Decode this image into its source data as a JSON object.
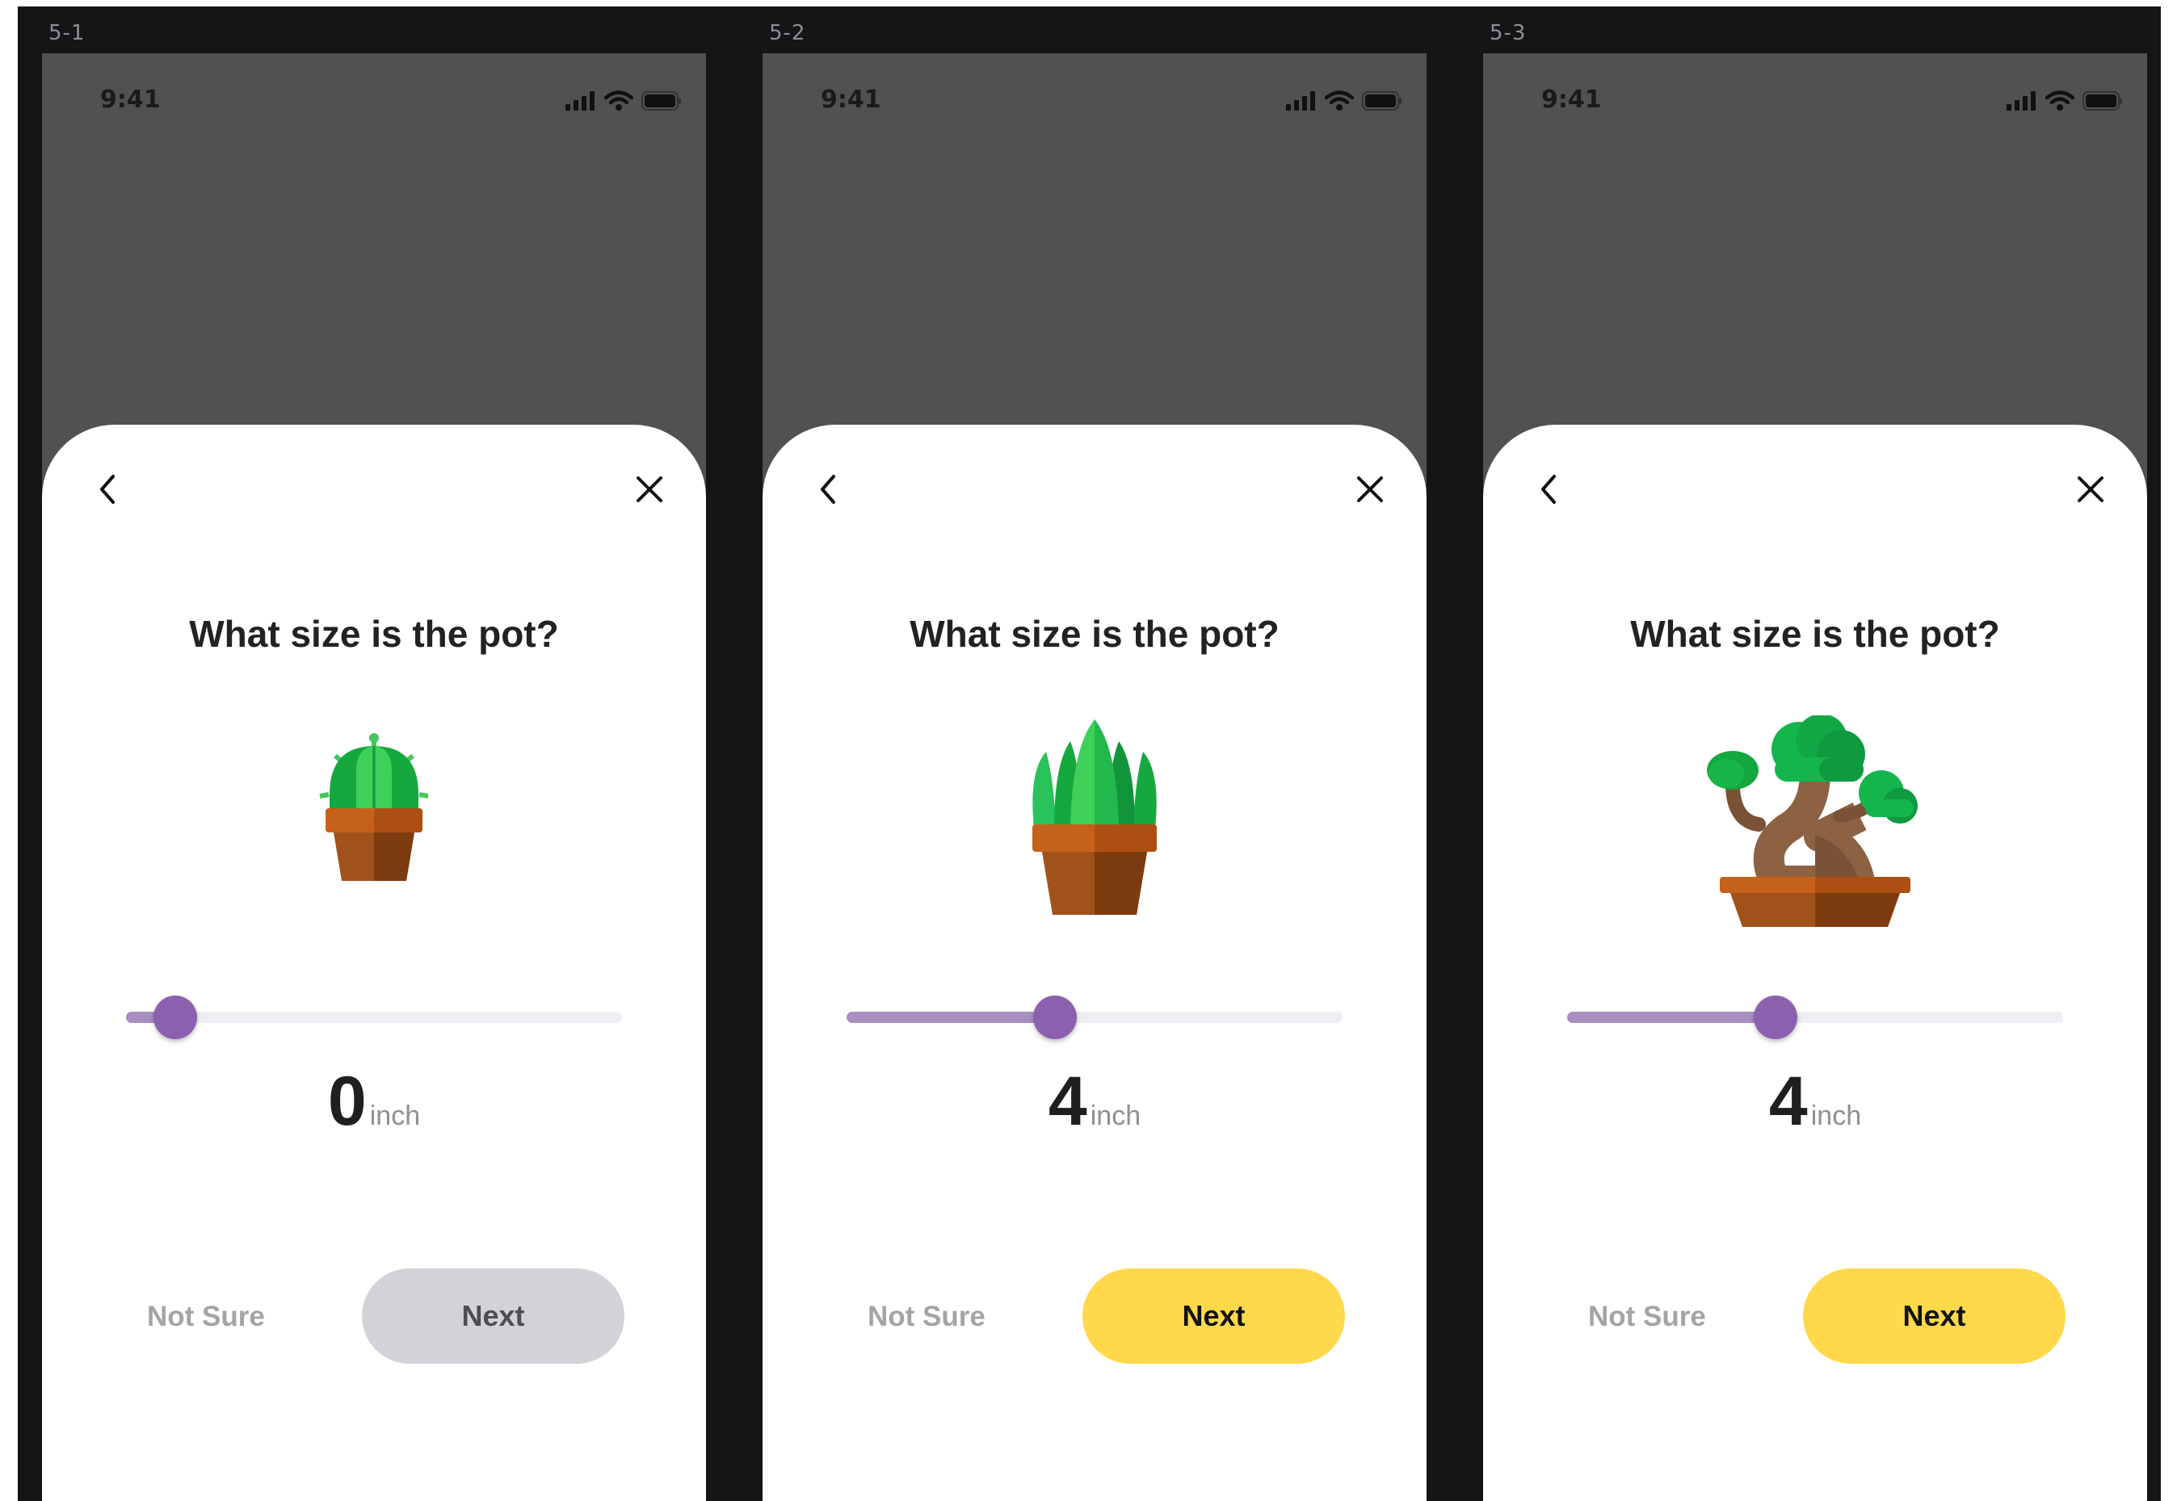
{
  "frames": [
    {
      "label": "5-1",
      "status_time": "9:41",
      "question": "What size is the pot?",
      "plant": "cactus",
      "slider_fraction": 0.1,
      "value": "0",
      "unit": "inch",
      "not_sure_label": "Not Sure",
      "next_label": "Next",
      "next_enabled": false
    },
    {
      "label": "5-2",
      "status_time": "9:41",
      "question": "What size is the pot?",
      "plant": "succulent",
      "slider_fraction": 0.42,
      "value": "4",
      "unit": "inch",
      "not_sure_label": "Not Sure",
      "next_label": "Next",
      "next_enabled": true
    },
    {
      "label": "5-3",
      "status_time": "9:41",
      "question": "What size is the pot?",
      "plant": "bonsai",
      "slider_fraction": 0.42,
      "value": "4",
      "unit": "inch",
      "not_sure_label": "Not Sure",
      "next_label": "Next",
      "next_enabled": true
    }
  ],
  "colors": {
    "accent_yellow": "#ffd84b",
    "slider_thumb": "#8c60ae",
    "slider_fill": "#a98fc1",
    "disabled_button": "#d3d2d8"
  }
}
